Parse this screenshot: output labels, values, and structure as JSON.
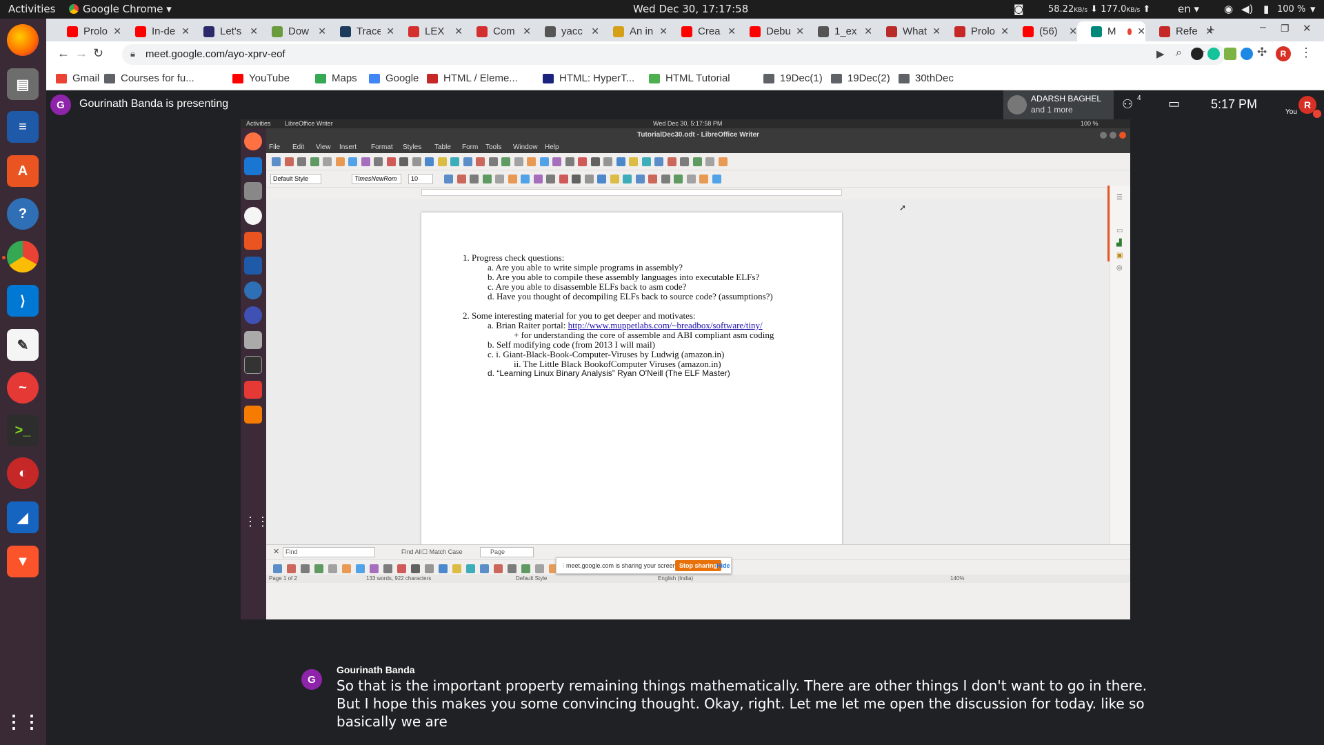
{
  "topbar": {
    "activities": "Activities",
    "app_name": "Google Chrome",
    "clock": "Wed Dec 30, 17:17:58",
    "net_down": "58.22",
    "net_down_unit": "KB/s",
    "net_up": "177.0",
    "net_up_unit": "KB/s",
    "lang": "en",
    "battery": "100 %"
  },
  "tabs": [
    {
      "label": "Prolo",
      "color": "#ff0000"
    },
    {
      "label": "In-de",
      "color": "#ff0000"
    },
    {
      "label": "Let's",
      "color": "#2b2b6b"
    },
    {
      "label": "Dow",
      "color": "#6a9b3c"
    },
    {
      "label": "Trace",
      "color": "#1d3b5a"
    },
    {
      "label": "LEX",
      "color": "#d32f2f"
    },
    {
      "label": "Com",
      "color": "#d32f2f"
    },
    {
      "label": "yacc",
      "color": "#555555"
    },
    {
      "label": "An in",
      "color": "#d4a017"
    },
    {
      "label": "Crea",
      "color": "#ff0000"
    },
    {
      "label": "Debu",
      "color": "#ff0000"
    },
    {
      "label": "1_ex",
      "color": "#555555"
    },
    {
      "label": "What",
      "color": "#b92b27"
    },
    {
      "label": "Prolo",
      "color": "#c62828"
    },
    {
      "label": "(56)",
      "color": "#ff0000"
    },
    {
      "label": "M",
      "color": "#00897b"
    },
    {
      "label": "Refe",
      "color": "#c62828"
    }
  ],
  "address": {
    "url": "meet.google.com/ayo-xprv-eof",
    "profile_initial": "R"
  },
  "bookmarks": [
    {
      "label": "Gmail",
      "color": "#ea4335"
    },
    {
      "label": "Courses for fu...",
      "color": "#5f6368"
    },
    {
      "label": "YouTube",
      "color": "#ff0000"
    },
    {
      "label": "Maps",
      "color": "#34a853"
    },
    {
      "label": "Google",
      "color": "#4285f4"
    },
    {
      "label": "HTML / Eleme...",
      "color": "#c62828"
    },
    {
      "label": "HTML: HyperT...",
      "color": "#1a237e"
    },
    {
      "label": "HTML Tutorial",
      "color": "#4caf50"
    },
    {
      "label": "19Dec(1)",
      "color": "#5f6368"
    },
    {
      "label": "19Dec(2)",
      "color": "#5f6368"
    },
    {
      "label": "30thDec",
      "color": "#5f6368"
    }
  ],
  "meet": {
    "presenter_initial": "G",
    "presenter_text": "Gourinath Banda is presenting",
    "participant_name": "ADARSH BAGHEL",
    "participant_more": "and 1 more",
    "participants_count": "4",
    "time": "5:17  PM",
    "you_label": "You",
    "you_initial": "R"
  },
  "shared": {
    "activities": "Activities",
    "app": "LibreOffice Writer",
    "clock": "Wed Dec 30,  5:17:58 PM",
    "battery": "100 %",
    "window_title": "TutorialDec30.odt - LibreOffice Writer",
    "menu": [
      "File",
      "Edit",
      "View",
      "Insert",
      "Format",
      "Styles",
      "Table",
      "Form",
      "Tools",
      "Window",
      "Help"
    ],
    "para_style": "Default Style",
    "font_name": "TimesNewRom",
    "font_size": "10",
    "doc_lines": [
      "1. Progress check questions:",
      "a. Are you able to write simple programs in assembly?",
      "b. Are you able to compile these assembly languages into executable ELFs?",
      "c. Are you able to disassemble ELFs back to asm code?",
      "d. Have you thought of decompiling ELFs back to source code? (assumptions?)",
      "2. Some interesting material for you to get deeper and motivates:",
      "a. Brian Raiter portal:",
      "+ for understanding the core of assemble and ABI compliant asm coding",
      "b. Self modifying code (from 2013 I will mail)",
      "c. i. Giant-Black-Book-Computer-Viruses by Ludwig (amazon.in)",
      "ii. The Little Black BookofComputer Viruses  (amazon.in)",
      "d. “Learning Linux Binary Analysis” Ryan O'Neill (The ELF Master)"
    ],
    "link": "http://www.muppetlabs.com/~breadbox/software/tiny/",
    "find_placeholder": "Find",
    "find_all": "Find All",
    "match_case": "Match Case",
    "nav_page": "Page",
    "share_text": "meet.google.com is sharing your screen.",
    "stop_sharing": "Stop sharing",
    "hide": "Hide",
    "status_page": "Page 1 of 2",
    "status_words": "133 words, 922 characters",
    "status_style": "Default Style",
    "status_lang": "English (India)",
    "status_zoom": "140%"
  },
  "caption": {
    "speaker_initial": "G",
    "speaker": "Gourinath Banda",
    "text": "So that is the important property remaining things mathematically. There are other things I don't want to go in there. But I hope this makes you some convincing thought. Okay, right. Let me let me open the discussion for today. like so basically we are"
  }
}
